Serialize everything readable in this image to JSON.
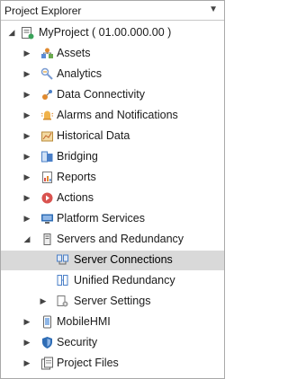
{
  "panel": {
    "title": "Project Explorer",
    "dropdown_glyph": "▼"
  },
  "tree": {
    "root": {
      "label": "MyProject ( 01.00.000.00 )"
    },
    "items": [
      {
        "label": "Assets",
        "icon": "assets-icon"
      },
      {
        "label": "Analytics",
        "icon": "analytics-icon"
      },
      {
        "label": "Data Connectivity",
        "icon": "data-connectivity-icon"
      },
      {
        "label": "Alarms and Notifications",
        "icon": "alarms-icon"
      },
      {
        "label": "Historical Data",
        "icon": "historical-data-icon"
      },
      {
        "label": "Bridging",
        "icon": "bridging-icon"
      },
      {
        "label": "Reports",
        "icon": "reports-icon"
      },
      {
        "label": "Actions",
        "icon": "actions-icon"
      },
      {
        "label": "Platform Services",
        "icon": "platform-services-icon"
      },
      {
        "label": "Servers and Redundancy",
        "icon": "servers-icon"
      },
      {
        "label": "Server Connections",
        "icon": "server-connections-icon"
      },
      {
        "label": "Unified Redundancy",
        "icon": "unified-redundancy-icon"
      },
      {
        "label": "Server Settings",
        "icon": "server-settings-icon"
      },
      {
        "label": "MobileHMI",
        "icon": "mobilehmi-icon"
      },
      {
        "label": "Security",
        "icon": "security-icon"
      },
      {
        "label": "Project Files",
        "icon": "project-files-icon"
      }
    ]
  },
  "colors": {
    "selection": "#d9d9d9",
    "accent": "#2f6db5"
  }
}
